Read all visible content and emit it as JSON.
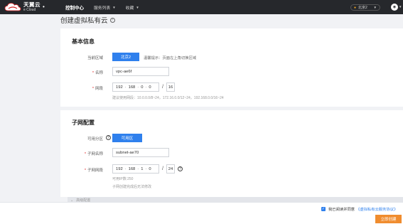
{
  "header": {
    "logo_main": "天翼云",
    "logo_sub": "e Cloud",
    "nav": [
      {
        "label": "控制中心",
        "active": true
      },
      {
        "label": "服务列表",
        "active": false
      },
      {
        "label": "收藏",
        "active": false
      }
    ],
    "region": "北京2"
  },
  "page": {
    "title": "创建虚拟私有云"
  },
  "basic": {
    "title": "基本信息",
    "region_label": "当前区域",
    "region_value": "北京2",
    "region_hint": "温馨提示：页面左上角切换区域",
    "name_label": "名称",
    "name_value": "vpc-ae6f",
    "cidr_label": "网段",
    "cidr": [
      "192",
      "168",
      "0",
      "0"
    ],
    "cidr_mask": "16",
    "cidr_hint": "建议使用网段：10.0.0.0/8~24，172.16.0.0/12~24，192.168.0.0/16~24"
  },
  "subnet": {
    "title": "子网配置",
    "az_label": "可用分区",
    "az_value": "可用区",
    "name_label": "子网名称",
    "name_value": "subnet-ae70",
    "cidr_label": "子网网段",
    "cidr": [
      "192",
      "168",
      "1",
      "0"
    ],
    "cidr_mask": "24",
    "ip_count": "可用IP数:250",
    "cidr_note": "子网创建完成后无法修改"
  },
  "advanced": {
    "label": "高级配置"
  },
  "footer": {
    "agree_text": "我已阅读并同意",
    "agree_link": "《虚拟私有云服务协议》",
    "submit_label": "立即创建"
  }
}
